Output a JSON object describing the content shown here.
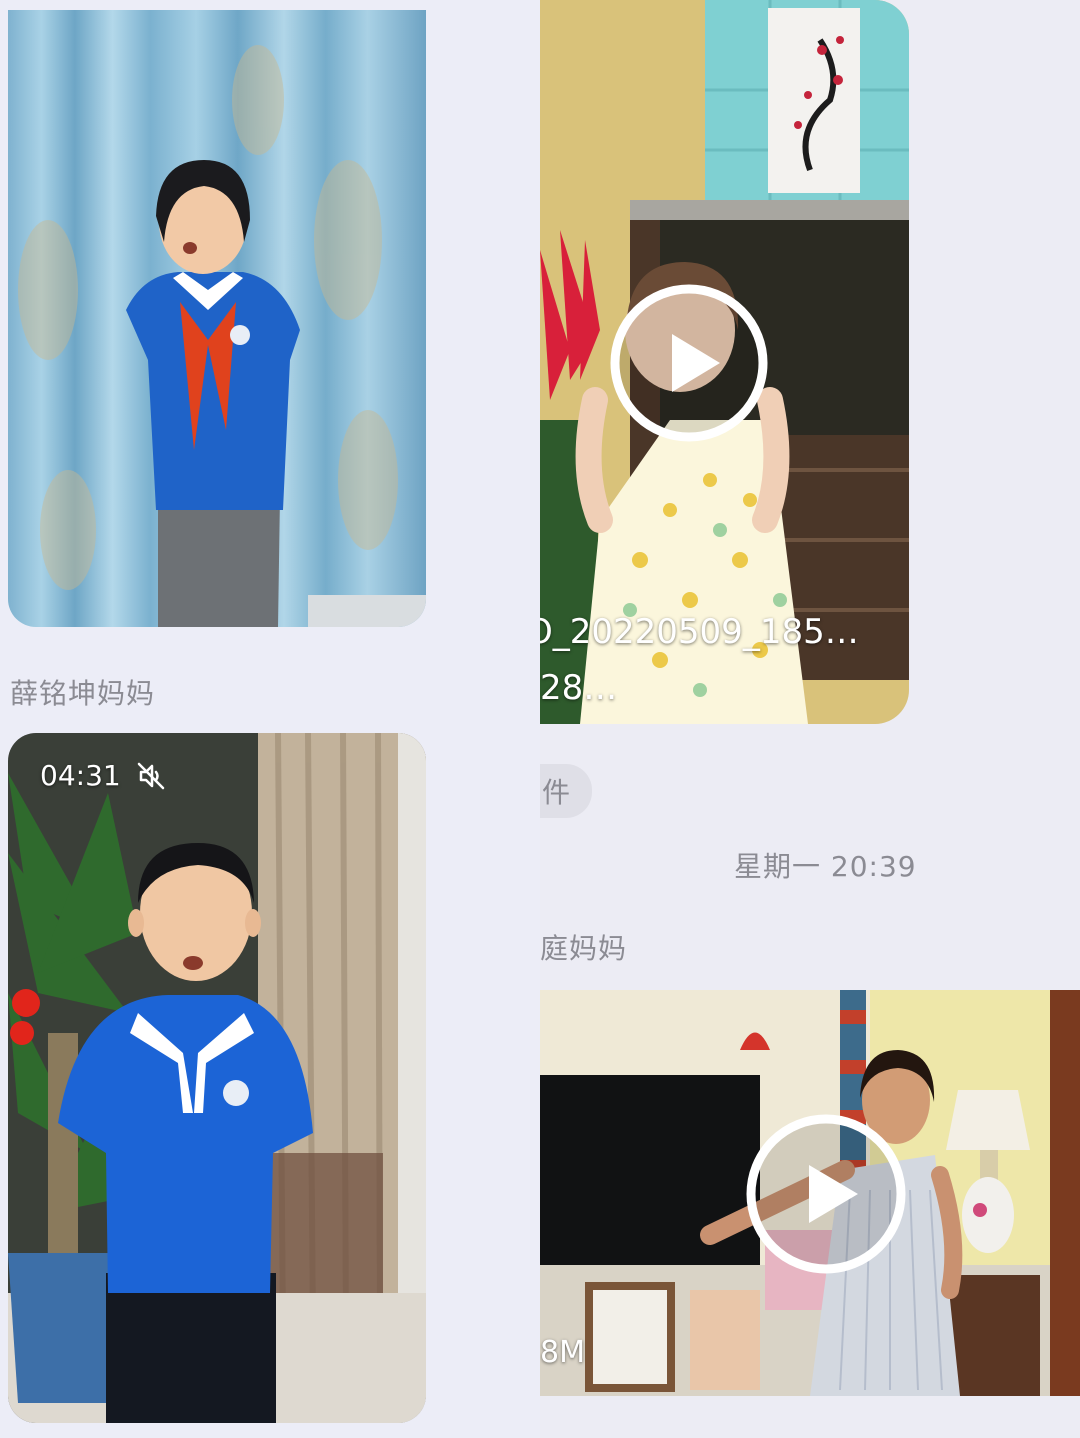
{
  "left": {
    "photo1": {
      "kind": "photo"
    },
    "sender1": "薛铭坤妈妈",
    "video2": {
      "duration": "04:31",
      "mute_icon": "speaker-muted-icon"
    }
  },
  "right": {
    "video1": {
      "filename_line1": "O_20220509_185…",
      "filename_line2": "28…",
      "play_icon": "play-circle-icon"
    },
    "file_pill": "件",
    "timestamp": "星期一 20:39",
    "sender2": "庭妈妈",
    "video3": {
      "size_text": "8M",
      "play_icon": "play-circle-icon"
    }
  }
}
